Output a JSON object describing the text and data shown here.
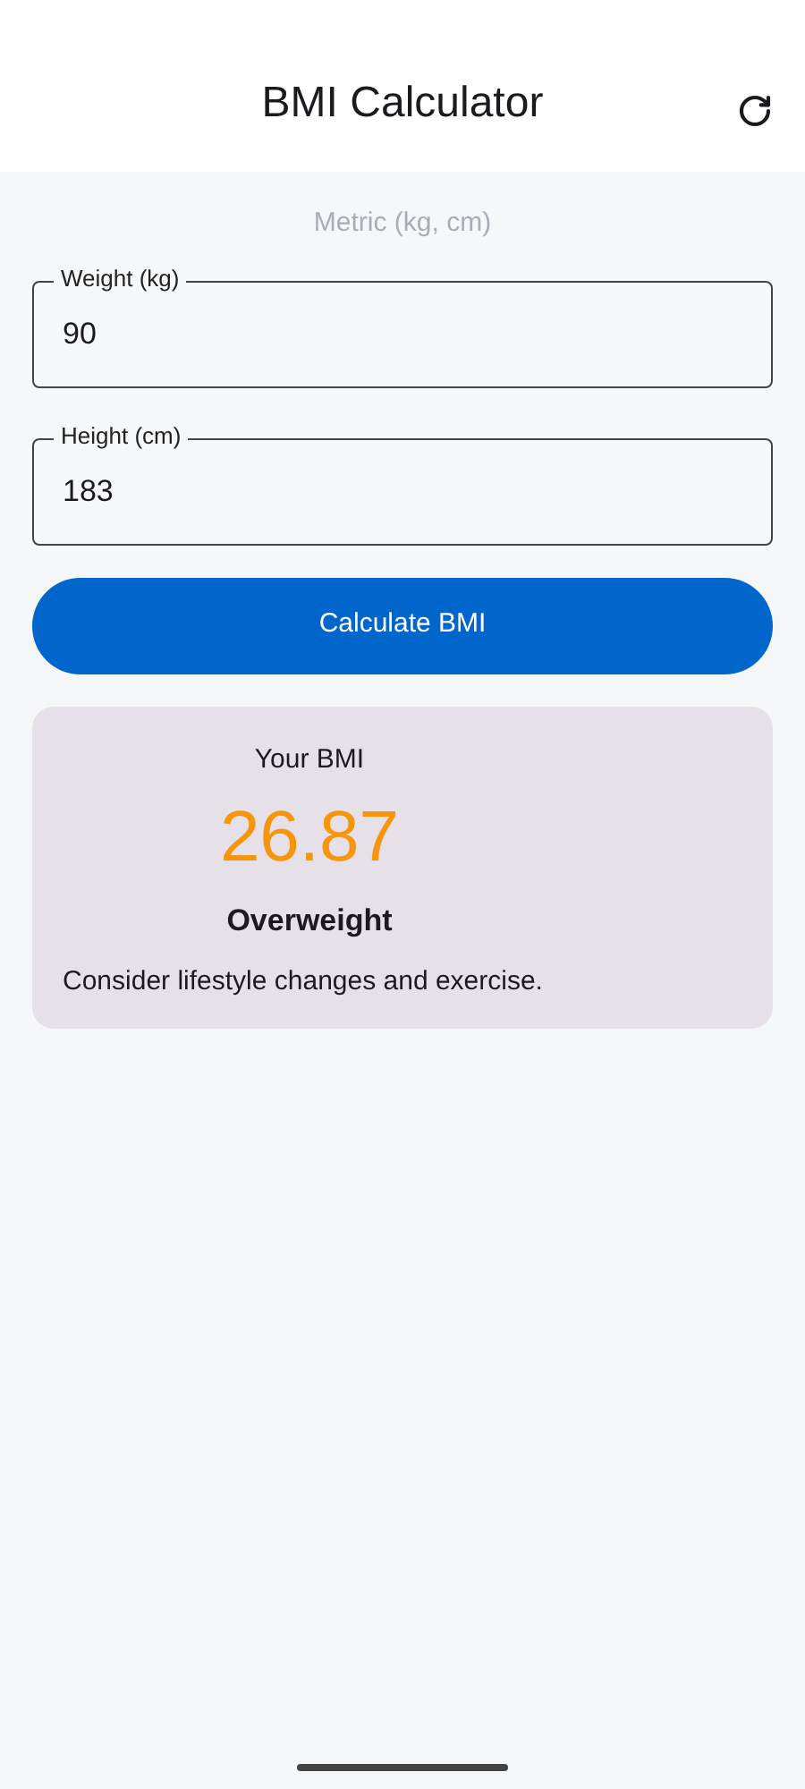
{
  "app_bar": {
    "title": "BMI Calculator"
  },
  "unit_label": "Metric (kg, cm)",
  "fields": [
    {
      "label": "Weight (kg)",
      "value": "90"
    },
    {
      "label": "Height (cm)",
      "value": "183"
    }
  ],
  "calculate_button": "Calculate BMI",
  "result": {
    "heading": "Your BMI",
    "value": "26.87",
    "category": "Overweight",
    "advice": "Consider lifestyle changes and exercise."
  }
}
